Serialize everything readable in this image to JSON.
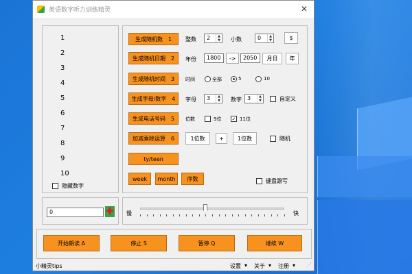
{
  "window": {
    "title": "英语数字听力训练精灵",
    "close_glyph": "✕"
  },
  "numbers": [
    "1",
    "2",
    "3",
    "4",
    "5",
    "6",
    "7",
    "8",
    "9",
    "10"
  ],
  "hide_numbers_label": "隐藏数字",
  "rows": {
    "random_number": {
      "button": "生成随机数",
      "key": "1",
      "int_label": "整数",
      "int_value": "2",
      "dec_label": "小数",
      "dec_value": "0",
      "dollar": "$"
    },
    "random_date": {
      "button": "生成随机日期",
      "key": "2",
      "year_label": "年份",
      "from": "1800",
      "arrow": "->",
      "to": "2050",
      "month_day": "月日",
      "year_btn": "年"
    },
    "random_time": {
      "button": "生成随机时间",
      "key": "3",
      "time_label": "时间",
      "opt_all": "全部",
      "opt_5": "5",
      "opt_10": "10"
    },
    "letters": {
      "button": "生成字母/数字",
      "key": "4",
      "letter_label": "字母",
      "letter_value": "3",
      "digit_label": "数字",
      "digit_value": "3",
      "custom_label": "自定义"
    },
    "phone": {
      "button": "生成电话号码",
      "key": "5",
      "digits_label": "位数",
      "opt_9": "9位",
      "opt_11": "11位"
    },
    "arith": {
      "button": "加减乘除运算",
      "key": "6",
      "left": "1位数",
      "op": "+",
      "right": "1位数",
      "random_label": "随机"
    },
    "tyteen": "ty/teen",
    "week": "week",
    "month": "month",
    "ordinal": "序数",
    "keyboard_label": "键盘跟写"
  },
  "answer_input": "0",
  "speed": {
    "slow": "慢",
    "fast": "快",
    "value": 0.45
  },
  "actions": {
    "start": "开始朗读 A",
    "stop": "停止 S",
    "pause": "暂停 Q",
    "resume": "继续 W"
  },
  "status": {
    "tips": "小精灵tips",
    "settings": "设置",
    "about": "关于",
    "register": "注册"
  }
}
